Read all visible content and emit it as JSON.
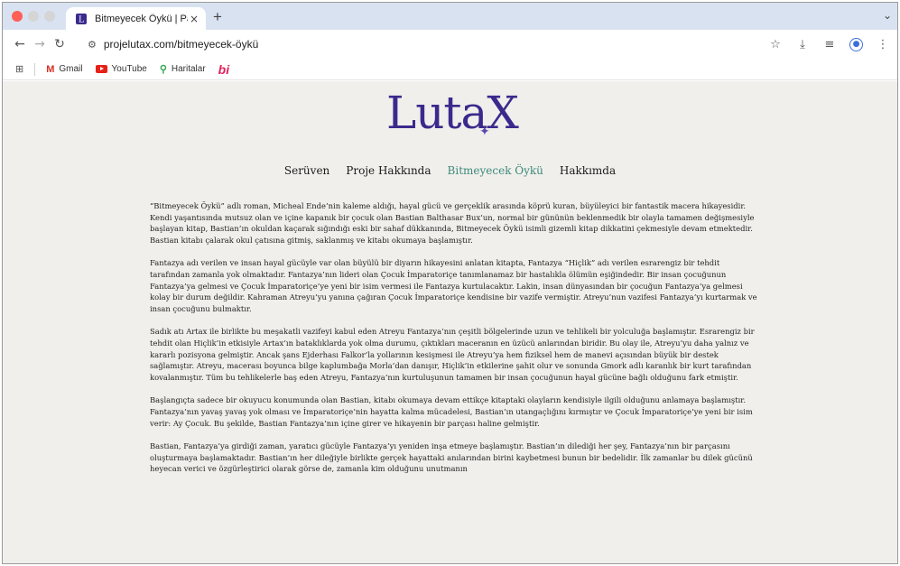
{
  "browser": {
    "tab_title": "Bitmeyecek Öykü | Pathia",
    "tab_close": "×",
    "new_tab": "+",
    "url": "projelutax.com/bitmeyecek-öykü"
  },
  "bookmarks": [
    {
      "label": "Gmail",
      "icon": "gmail-icon"
    },
    {
      "label": "YouTube",
      "icon": "youtube-icon"
    },
    {
      "label": "Haritalar",
      "icon": "maps-icon"
    }
  ],
  "bookmark_bi": "bi",
  "site": {
    "logo": "LutaX",
    "nav": [
      {
        "label": "Serüven"
      },
      {
        "label": "Proje Hakkında"
      },
      {
        "label": "Bitmeyecek Öykü",
        "active": true
      },
      {
        "label": "Hakkımda"
      }
    ]
  },
  "article": {
    "paragraphs": [
      "“Bitmeyecek Öykü” adlı roman, Micheal Ende’nin kaleme aldığı, hayal gücü ve gerçeklik arasında köprü kuran, büyüleyici bir fantastik macera hikayesidir. Kendi yaşantısında mutsuz olan ve içine kapanık bir çocuk olan Bastian Balthasar Bux’un, normal bir gününün beklenmedik bir olayla tamamen değişmesiyle başlayan kitap, Bastian’ın okuldan kaçarak sığındığı eski bir sahaf dükkanında, Bitmeyecek Öykü isimli gizemli kitap dikkatini çekmesiyle devam etmektedir. Bastian kitabı çalarak okul çatısına gitmiş, saklanmış ve kitabı okumaya başlamıştır.",
      "Fantazya adı verilen ve insan hayal gücüyle var olan büyülü bir diyarın hikayesini anlatan kitapta, Fantazya “Hiçlik” adı verilen esrarengiz bir tehdit tarafından zamanla yok olmaktadır. Fantazya’nın lideri olan Çocuk İmparatoriçe tanımlanamaz bir hastalıkla ölümün eşiğindedir. Bir insan çocuğunun Fantazya’ya gelmesi ve Çocuk İmparatoriçe’ye yeni bir isim vermesi ile Fantazya kurtulacaktır. Lakin, insan dünyasından bir çocuğun Fantazya’ya gelmesi kolay bir durum değildir. Kahraman Atreyu’yu yanına çağıran Çocuk İmparatoriçe kendisine bir vazife vermiştir. Atreyu’nun vazifesi Fantazya’yı kurtarmak ve insan çocuğunu bulmaktır.",
      "Sadık atı Artax ile birlikte bu meşakatli vazifeyi kabul eden Atreyu  Fantazya’nın çeşitli bölgelerinde uzun ve tehlikeli bir yolculuğa başlamıştır. Esrarengiz bir tehdit olan Hiçlik’in etkisiyle Artax’ın bataklıklarda yok olma durumu, çıktıkları maceranın en üzücü anlarından biridir. Bu olay ile, Atreyu’yu daha yalnız ve kararlı pozisyona gelmiştir. Ancak şans Ejderhası Falkor’la yollarının kesişmesi ile Atreyu’ya hem fiziksel hem de manevi açısından büyük bir destek sağlamıştır. Atreyu, macerası boyunca bilge kaplumbağa Morla’dan danışır, Hiçlik’in etkilerine şahit olur ve sonunda Gmork adlı karanlık bir kurt tarafından kovalanmıştır. Tüm bu tehlikelerle baş eden Atreyu, Fantazya’nın kurtuluşunun tamamen bir insan çocuğunun hayal gücüne bağlı olduğunu fark etmiştir.",
      "Başlangıçta sadece bir okuyucu konumunda olan Bastian, kitabı okumaya devam ettikçe kitaptaki olayların kendisiyle ilgili olduğunu anlamaya başlamıştır. Fantazya’nın yavaş yavaş yok olması ve İmparatoriçe’nin hayatta kalma mücadelesi, Bastian’ın utangaçlığını kırmıştır ve Çocuk İmparatoriçe’ye yeni bir isim verir: Ay Çocuk. Bu şekilde, Bastian Fantazya’nın içine girer ve hikayenin bir parçası haline gelmiştir.",
      "Bastian, Fantazya’ya girdiği zaman, yaratıcı gücüyle Fantazya’yı yeniden inşa etmeye başlamıştır. Bastian’ın dilediği her şey, Fantazya’nın bir parçasını oluşturmaya başlamaktadır. Bastian’ın her dileğiyle birlikte gerçek hayattaki anılarından birini kaybetmesi bunun bir bedelidir. İlk zamanlar bu dilek gücünü heyecan verici ve özgürleştirici olarak görse de, zamanla kim olduğunu unutmanın"
    ]
  }
}
